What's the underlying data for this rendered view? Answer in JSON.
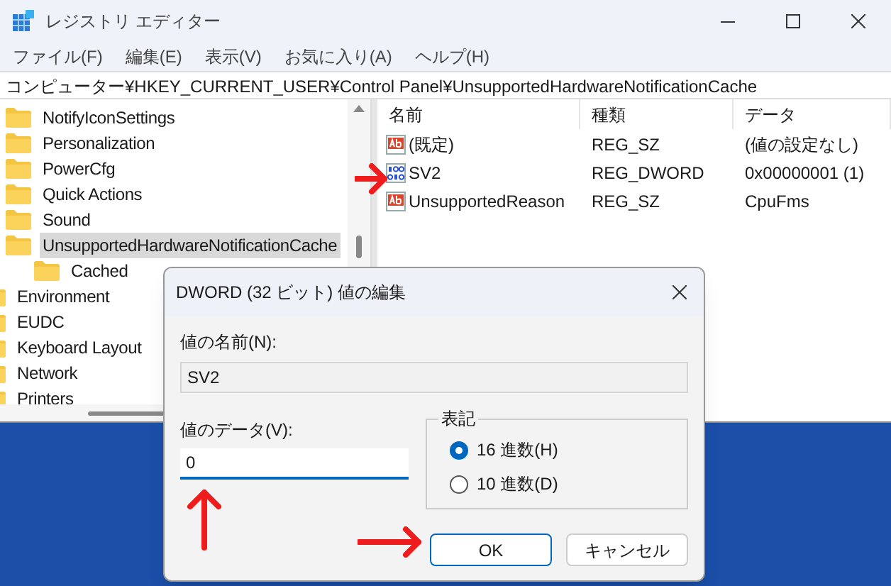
{
  "window": {
    "title": "レジストリ エディター"
  },
  "menu": [
    "ファイル(F)",
    "編集(E)",
    "表示(V)",
    "お気に入り(A)",
    "ヘルプ(H)"
  ],
  "address": "コンピューター¥HKEY_CURRENT_USER¥Control Panel¥UnsupportedHardwareNotificationCache",
  "tree": {
    "inner_items": [
      {
        "label": "NotifyIconSettings",
        "selected": false
      },
      {
        "label": "Personalization",
        "selected": false
      },
      {
        "label": "PowerCfg",
        "selected": false
      },
      {
        "label": "Quick Actions",
        "selected": false
      },
      {
        "label": "Sound",
        "selected": false
      },
      {
        "label": "UnsupportedHardwareNotificationCache",
        "selected": true,
        "children": [
          {
            "label": "Cached",
            "selected": false
          }
        ]
      }
    ],
    "items": [
      {
        "label": "Environment",
        "selected": false
      },
      {
        "label": "EUDC",
        "selected": false
      },
      {
        "label": "Keyboard Layout",
        "selected": false
      },
      {
        "label": "Network",
        "selected": false
      },
      {
        "label": "Printers",
        "selected": false
      }
    ]
  },
  "list": {
    "columns": [
      "名前",
      "種類",
      "データ"
    ],
    "rows": [
      {
        "kind": "string",
        "name": "(既定)",
        "type": "REG_SZ",
        "data": "(値の設定なし)"
      },
      {
        "kind": "dword",
        "name": "SV2",
        "type": "REG_DWORD",
        "data": "0x00000001 (1)"
      },
      {
        "kind": "string",
        "name": "UnsupportedReason",
        "type": "REG_SZ",
        "data": "CpuFms"
      }
    ]
  },
  "dialog": {
    "title": "DWORD (32 ビット) 値の編集",
    "name_label": "値の名前(N):",
    "name_value": "SV2",
    "data_label": "値のデータ(V):",
    "data_value": "0",
    "base": {
      "label": "表記",
      "options": [
        {
          "label": "16 進数(H)",
          "selected": true
        },
        {
          "label": "10 進数(D)",
          "selected": false
        }
      ]
    },
    "buttons": [
      {
        "label": "OK",
        "primary": true
      },
      {
        "label": "キャンセル",
        "primary": false
      }
    ]
  }
}
